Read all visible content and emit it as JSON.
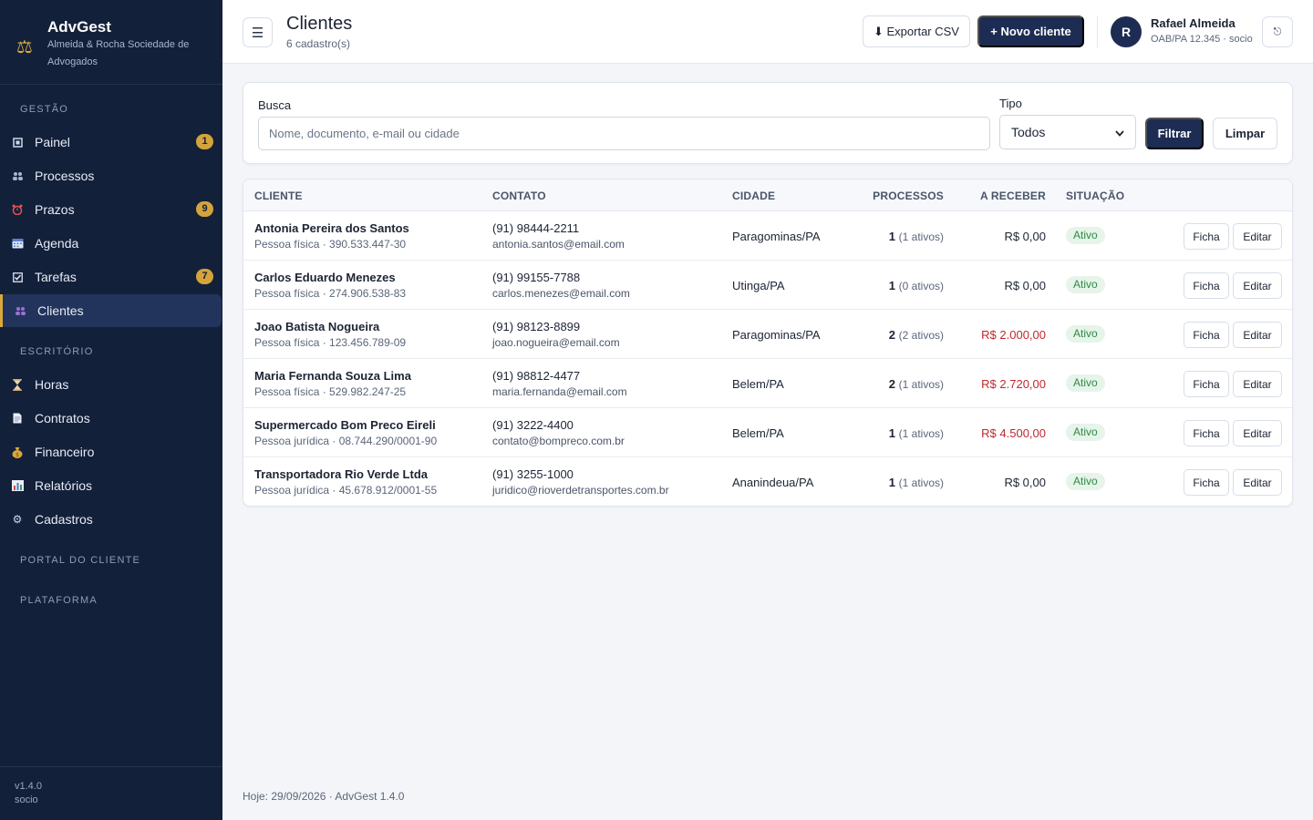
{
  "brand": {
    "title": "AdvGest",
    "subtitle": "Almeida & Rocha Sociedade de Advogados"
  },
  "sidebar": {
    "section_gestao": "GESTÃO",
    "section_escritorio": "ESCRITÓRIO",
    "section_portal": "PORTAL DO CLIENTE",
    "section_plataforma": "PLATAFORMA",
    "items": [
      {
        "label": "Painel",
        "icon": "dashboard-icon",
        "badge": "1"
      },
      {
        "label": "Processos",
        "icon": "people-icon",
        "badge": ""
      },
      {
        "label": "Prazos",
        "icon": "alarm-clock-icon",
        "badge": "9"
      },
      {
        "label": "Agenda",
        "icon": "calendar-icon",
        "badge": ""
      },
      {
        "label": "Tarefas",
        "icon": "checkbox-icon",
        "badge": "7"
      },
      {
        "label": "Clientes",
        "icon": "users-icon",
        "badge": "",
        "active": true
      },
      {
        "label": "Horas",
        "icon": "hourglass-icon",
        "badge": ""
      },
      {
        "label": "Contratos",
        "icon": "document-icon",
        "badge": ""
      },
      {
        "label": "Financeiro",
        "icon": "money-bag-icon",
        "badge": ""
      },
      {
        "label": "Relatórios",
        "icon": "bar-chart-icon",
        "badge": ""
      },
      {
        "label": "Cadastros",
        "icon": "gear-icon",
        "badge": ""
      }
    ],
    "footer_version": "v1.4.0",
    "footer_role": "socio"
  },
  "header": {
    "title": "Clientes",
    "subtitle": "6 cadastro(s)",
    "export_label": "⬇ Exportar CSV",
    "new_label": "+ Novo cliente",
    "avatar_initial": "R",
    "user_name": "Rafael Almeida",
    "user_role": "OAB/PA 12.345 · socio"
  },
  "filters": {
    "search_label": "Busca",
    "search_placeholder": "Nome, documento, e-mail ou cidade",
    "type_label": "Tipo",
    "type_value": "Todos",
    "filter_label": "Filtrar",
    "clear_label": "Limpar"
  },
  "table": {
    "headers": {
      "cliente": "CLIENTE",
      "contato": "CONTATO",
      "cidade": "CIDADE",
      "processos": "PROCESSOS",
      "a_receber": "A RECEBER",
      "situacao": "SITUAÇÃO"
    },
    "rows": [
      {
        "name": "Antonia Pereira dos Santos",
        "doc": "Pessoa física · 390.533.447-30",
        "phone": "(91) 98444-2211",
        "email": "antonia.santos@email.com",
        "city": "Paragominas/PA",
        "proc": "1",
        "proc_active": "(1 ativos)",
        "amount": "R$ 0,00",
        "due": false,
        "status": "Ativo"
      },
      {
        "name": "Carlos Eduardo Menezes",
        "doc": "Pessoa física · 274.906.538-83",
        "phone": "(91) 99155-7788",
        "email": "carlos.menezes@email.com",
        "city": "Utinga/PA",
        "proc": "1",
        "proc_active": "(0 ativos)",
        "amount": "R$ 0,00",
        "due": false,
        "status": "Ativo"
      },
      {
        "name": "Joao Batista Nogueira",
        "doc": "Pessoa física · 123.456.789-09",
        "phone": "(91) 98123-8899",
        "email": "joao.nogueira@email.com",
        "city": "Paragominas/PA",
        "proc": "2",
        "proc_active": "(2 ativos)",
        "amount": "R$ 2.000,00",
        "due": true,
        "status": "Ativo"
      },
      {
        "name": "Maria Fernanda Souza Lima",
        "doc": "Pessoa física · 529.982.247-25",
        "phone": "(91) 98812-4477",
        "email": "maria.fernanda@email.com",
        "city": "Belem/PA",
        "proc": "2",
        "proc_active": "(1 ativos)",
        "amount": "R$ 2.720,00",
        "due": true,
        "status": "Ativo"
      },
      {
        "name": "Supermercado Bom Preco Eireli",
        "doc": "Pessoa jurídica · 08.744.290/0001-90",
        "phone": "(91) 3222-4400",
        "email": "contato@bompreco.com.br",
        "city": "Belem/PA",
        "proc": "1",
        "proc_active": "(1 ativos)",
        "amount": "R$ 4.500,00",
        "due": true,
        "status": "Ativo"
      },
      {
        "name": "Transportadora Rio Verde Ltda",
        "doc": "Pessoa jurídica · 45.678.912/0001-55",
        "phone": "(91) 3255-1000",
        "email": "juridico@rioverdetransportes.com.br",
        "city": "Ananindeua/PA",
        "proc": "1",
        "proc_active": "(1 ativos)",
        "amount": "R$ 0,00",
        "due": false,
        "status": "Ativo"
      }
    ],
    "ficha_label": "Ficha",
    "editar_label": "Editar"
  },
  "footer": {
    "text": "Hoje: 29/09/2026 · AdvGest 1.4.0"
  },
  "colors": {
    "sidebar_bg": "#13203a",
    "accent_gold": "#d4a43b",
    "primary_dark": "#1d2c52",
    "due_red": "#c0282f",
    "status_green": "#2f8a45"
  }
}
